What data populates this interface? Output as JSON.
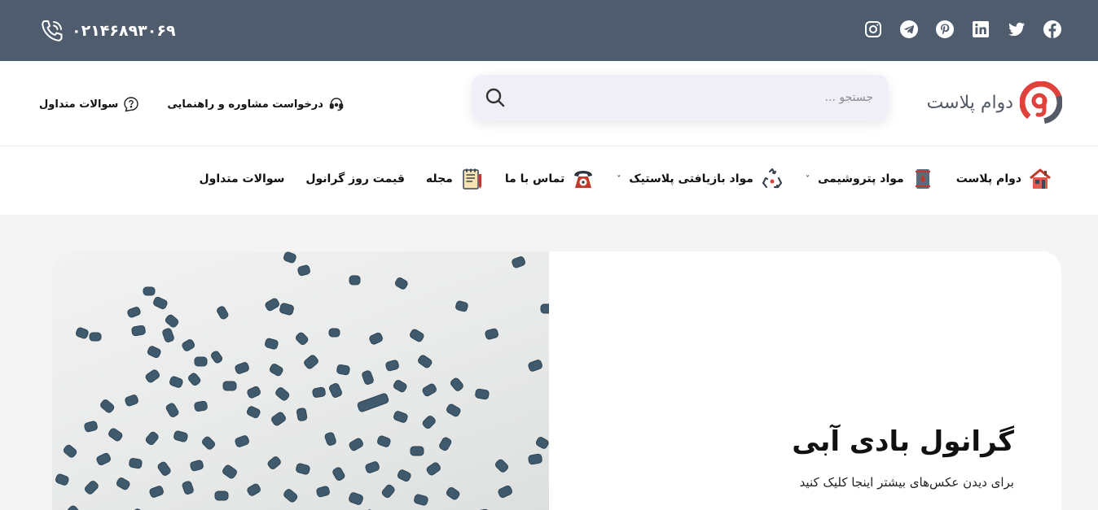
{
  "topbar": {
    "phone": "۰۲۱۴۶۸۹۳۰۶۹",
    "bg_color": "#4e5c6e",
    "social_icons": [
      "instagram-icon",
      "telegram-icon",
      "pinterest-icon",
      "linkedin-icon",
      "twitter-icon",
      "facebook-icon"
    ]
  },
  "header": {
    "logo_text": "دوام پلاست",
    "search_placeholder": "جستجو ...",
    "links": [
      {
        "label": "درخواست مشاوره و راهنمایی",
        "icon": "headset-icon"
      },
      {
        "label": "سوالات متداول",
        "icon": "question-icon"
      }
    ]
  },
  "nav": {
    "items": [
      {
        "label": "دوام پلاست",
        "icon": "house-icon",
        "dropdown": false
      },
      {
        "label": "مواد پتروشیمی",
        "icon": "barrel-icon",
        "dropdown": true
      },
      {
        "label": "مواد بازیافتی پلاستیک",
        "icon": "recycle-icon",
        "dropdown": true
      },
      {
        "label": "تماس با ما",
        "icon": "telephone-icon",
        "dropdown": false
      },
      {
        "label": "مجله",
        "icon": "notepad-icon",
        "dropdown": false
      },
      {
        "label": "قیمت روز گرانول",
        "icon": "",
        "dropdown": false
      },
      {
        "label": "سوالات متداول",
        "icon": "",
        "dropdown": false
      }
    ]
  },
  "product": {
    "title": "گرانول بادی آبی",
    "subtitle": "برای دیدن عکس‌های بیشتر اینجا کلیک کنید",
    "granule_color": "#3f5a6c"
  },
  "colors": {
    "brand_red": "#e0413b",
    "brand_gray": "#545b66",
    "page_bg": "#f4f4f5"
  }
}
